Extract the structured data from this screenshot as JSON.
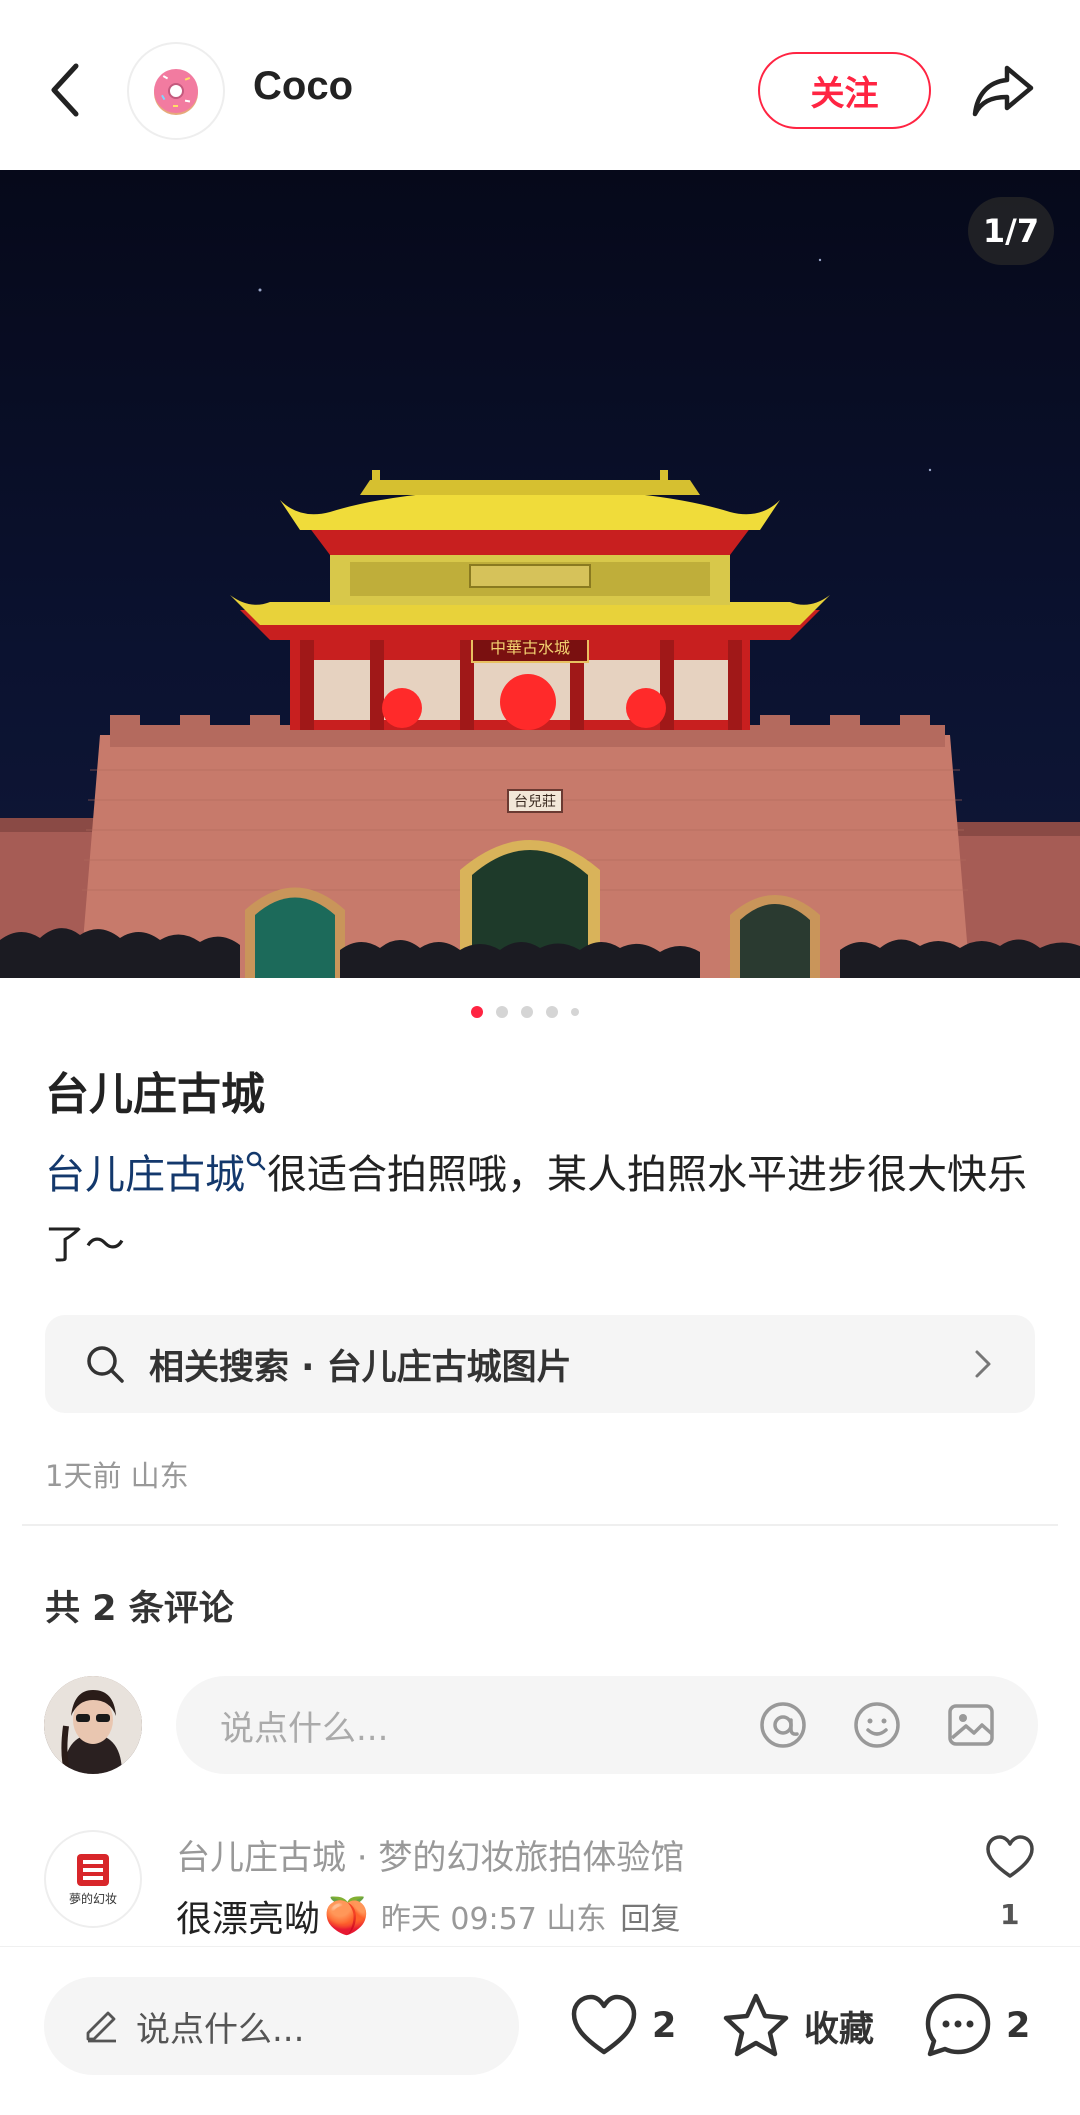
{
  "header": {
    "author_name": "Coco",
    "follow_label": "关注"
  },
  "photo": {
    "counter": "1/7",
    "plaque_top": "中華古水城",
    "plaque_gate": "台兒莊",
    "dot_count": 5,
    "active_dot": 0
  },
  "note": {
    "title": "台儿庄古城",
    "tag_link": "台儿庄古城",
    "body": "很适合拍照哦，某人拍照水平进步很大快乐了～"
  },
  "related_search": {
    "label": "相关搜索 · 台儿庄古城图片"
  },
  "meta": {
    "time_location": "1天前 山东"
  },
  "comments": {
    "total_label": "共 2 条评论",
    "input_placeholder": "说点什么...",
    "items": [
      {
        "author": "台儿庄古城 · 梦的幻妆旅拍体验馆",
        "avatar_text": "夢的幻妆",
        "text": "很漂亮呦",
        "emoji": "🍑",
        "time_location": "昨天 09:57 山东",
        "reply_label": "回复",
        "likes": "1"
      }
    ]
  },
  "bottom_bar": {
    "input_placeholder": "说点什么...",
    "likes": "2",
    "collect_label": "收藏",
    "comments": "2"
  },
  "colors": {
    "accent": "#ff2442",
    "tag_link": "#13386c",
    "muted_text": "#999999"
  }
}
